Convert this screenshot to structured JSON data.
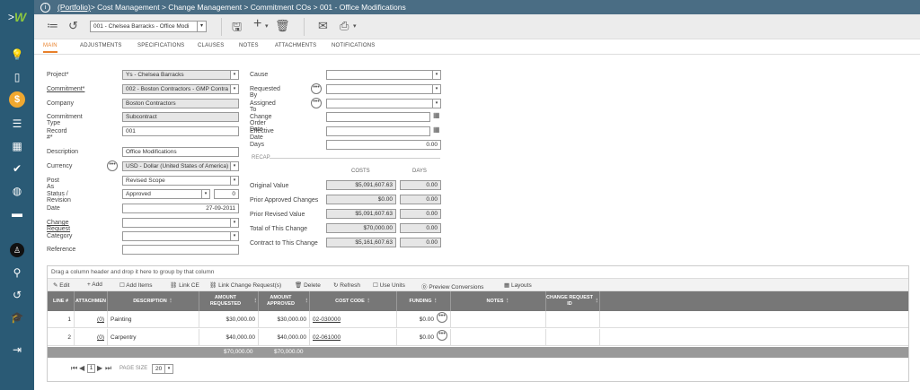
{
  "breadcrumb": {
    "root": "(Portfolio)",
    "path": " > Cost Management > Change Management > Commitment COs > 001 - Office Modifications"
  },
  "toolbar": {
    "record_select": "001 - Chelsea Barracks - Office Modi"
  },
  "tabs": [
    "MAIN",
    "ADJUSTMENTS",
    "SPECIFICATIONS",
    "CLAUSES",
    "NOTES",
    "ATTACHMENTS",
    "NOTIFICATIONS"
  ],
  "form": {
    "project_label": "Project*",
    "project_value": "Ys - Chelsea Barracks",
    "commitment_label": "Commitment*",
    "commitment_value": "002 - Boston Contractors - GMP Contra",
    "company_label": "Company",
    "company_value": "Boston Contractors",
    "ctype_label": "Commitment Type",
    "ctype_value": "Subcontract",
    "record_label": "Record #*",
    "record_value": "001",
    "desc_label": "Description",
    "desc_value": "Office Modifications",
    "currency_label": "Currency",
    "currency_value": "USD - Dollar (United States of America)",
    "postas_label": "Post As",
    "postas_value": "Revised Scope",
    "status_label": "Status / Revision",
    "status_value": "Approved",
    "revision_value": "0",
    "date_label": "Date",
    "date_value": "27-09-2011",
    "cr_label": "Change Request",
    "cr_value": "",
    "category_label": "Category",
    "category_value": "",
    "reference_label": "Reference",
    "reference_value": "",
    "cause_label": "Cause",
    "reqby_label": "Requested By",
    "assigned_label": "Assigned To",
    "cod_label": "Change Order Date",
    "eff_label": "Effective Date",
    "days_label": "Days",
    "days_value": "0.00"
  },
  "recap": {
    "title": "RECAP",
    "costs_header": "COSTS",
    "days_header": "DAYS",
    "rows": [
      {
        "label": "Original Value",
        "cost": "$5,091,607.63",
        "days": "0.00"
      },
      {
        "label": "Prior Approved Changes",
        "cost": "$0.00",
        "days": "0.00"
      },
      {
        "label": "Prior Revised Value",
        "cost": "$5,091,607.63",
        "days": "0.00"
      },
      {
        "label": "Total of This Change",
        "cost": "$70,000.00",
        "days": "0.00"
      },
      {
        "label": "Contract to This Change",
        "cost": "$5,161,607.63",
        "days": "0.00"
      }
    ]
  },
  "grid": {
    "group_hint": "Drag a column header and drop it here to group by that column",
    "tools": [
      "Edit",
      "Add",
      "Add Items",
      "Link CE",
      "Link Change Request(s)",
      "Delete",
      "Refresh",
      "Use Units",
      "Preview Conversions",
      "Layouts"
    ],
    "headers": [
      "LINE #",
      "ATTACHMEN",
      "DESCRIPTION",
      "AMOUNT REQUESTED",
      "AMOUNT APPROVED",
      "COST CODE",
      "FUNDING",
      "NOTES",
      "CHANGE REQUEST ID"
    ],
    "rows": [
      {
        "line": "1",
        "att": "(0)",
        "desc": "Painting",
        "req": "$30,000.00",
        "app": "$30,000.00",
        "code": "02-030000",
        "fund": "$0.00"
      },
      {
        "line": "2",
        "att": "(0)",
        "desc": "Carpentry",
        "req": "$40,000.00",
        "app": "$40,000.00",
        "code": "02-061000",
        "fund": "$0.00"
      }
    ],
    "totals": {
      "req": "$70,000.00",
      "app": "$70,000.00"
    },
    "page_current": "1",
    "page_size_label": "PAGE SIZE",
    "page_size": "20"
  }
}
